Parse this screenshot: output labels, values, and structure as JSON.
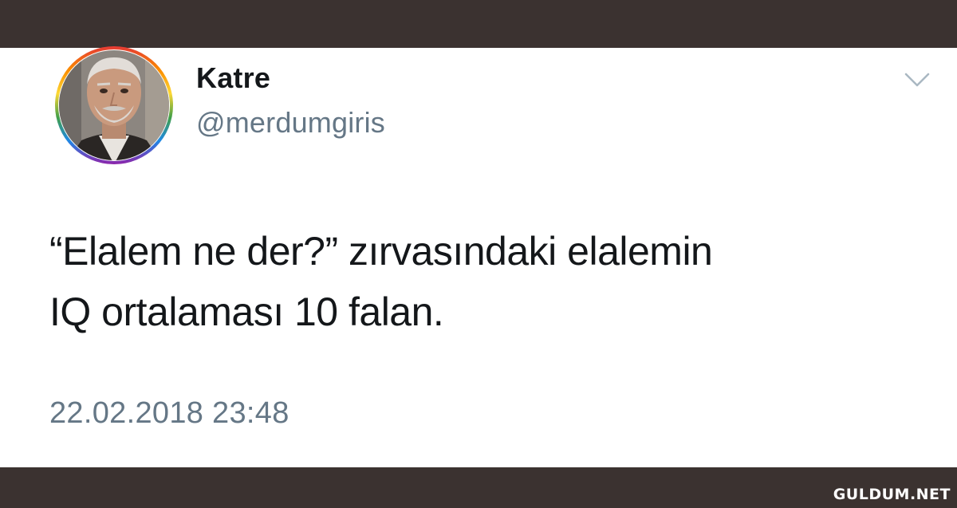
{
  "tweet": {
    "display_name": "Katre",
    "handle": "@merdumgiris",
    "text_line1": "“Elalem ne der?” zırvasındaki elalemin",
    "text_line2": "IQ ortalaması 10 falan.",
    "timestamp": "22.02.2018 23:48",
    "menu_icon": "chevron-down-icon",
    "avatar_icon": "avatar"
  },
  "watermark": {
    "text": "GULDUM.NET"
  },
  "colors": {
    "frame": "#3b3230",
    "card": "#ffffff",
    "text_primary": "#14171a",
    "text_secondary": "#657786",
    "chevron": "#aab8c2"
  }
}
